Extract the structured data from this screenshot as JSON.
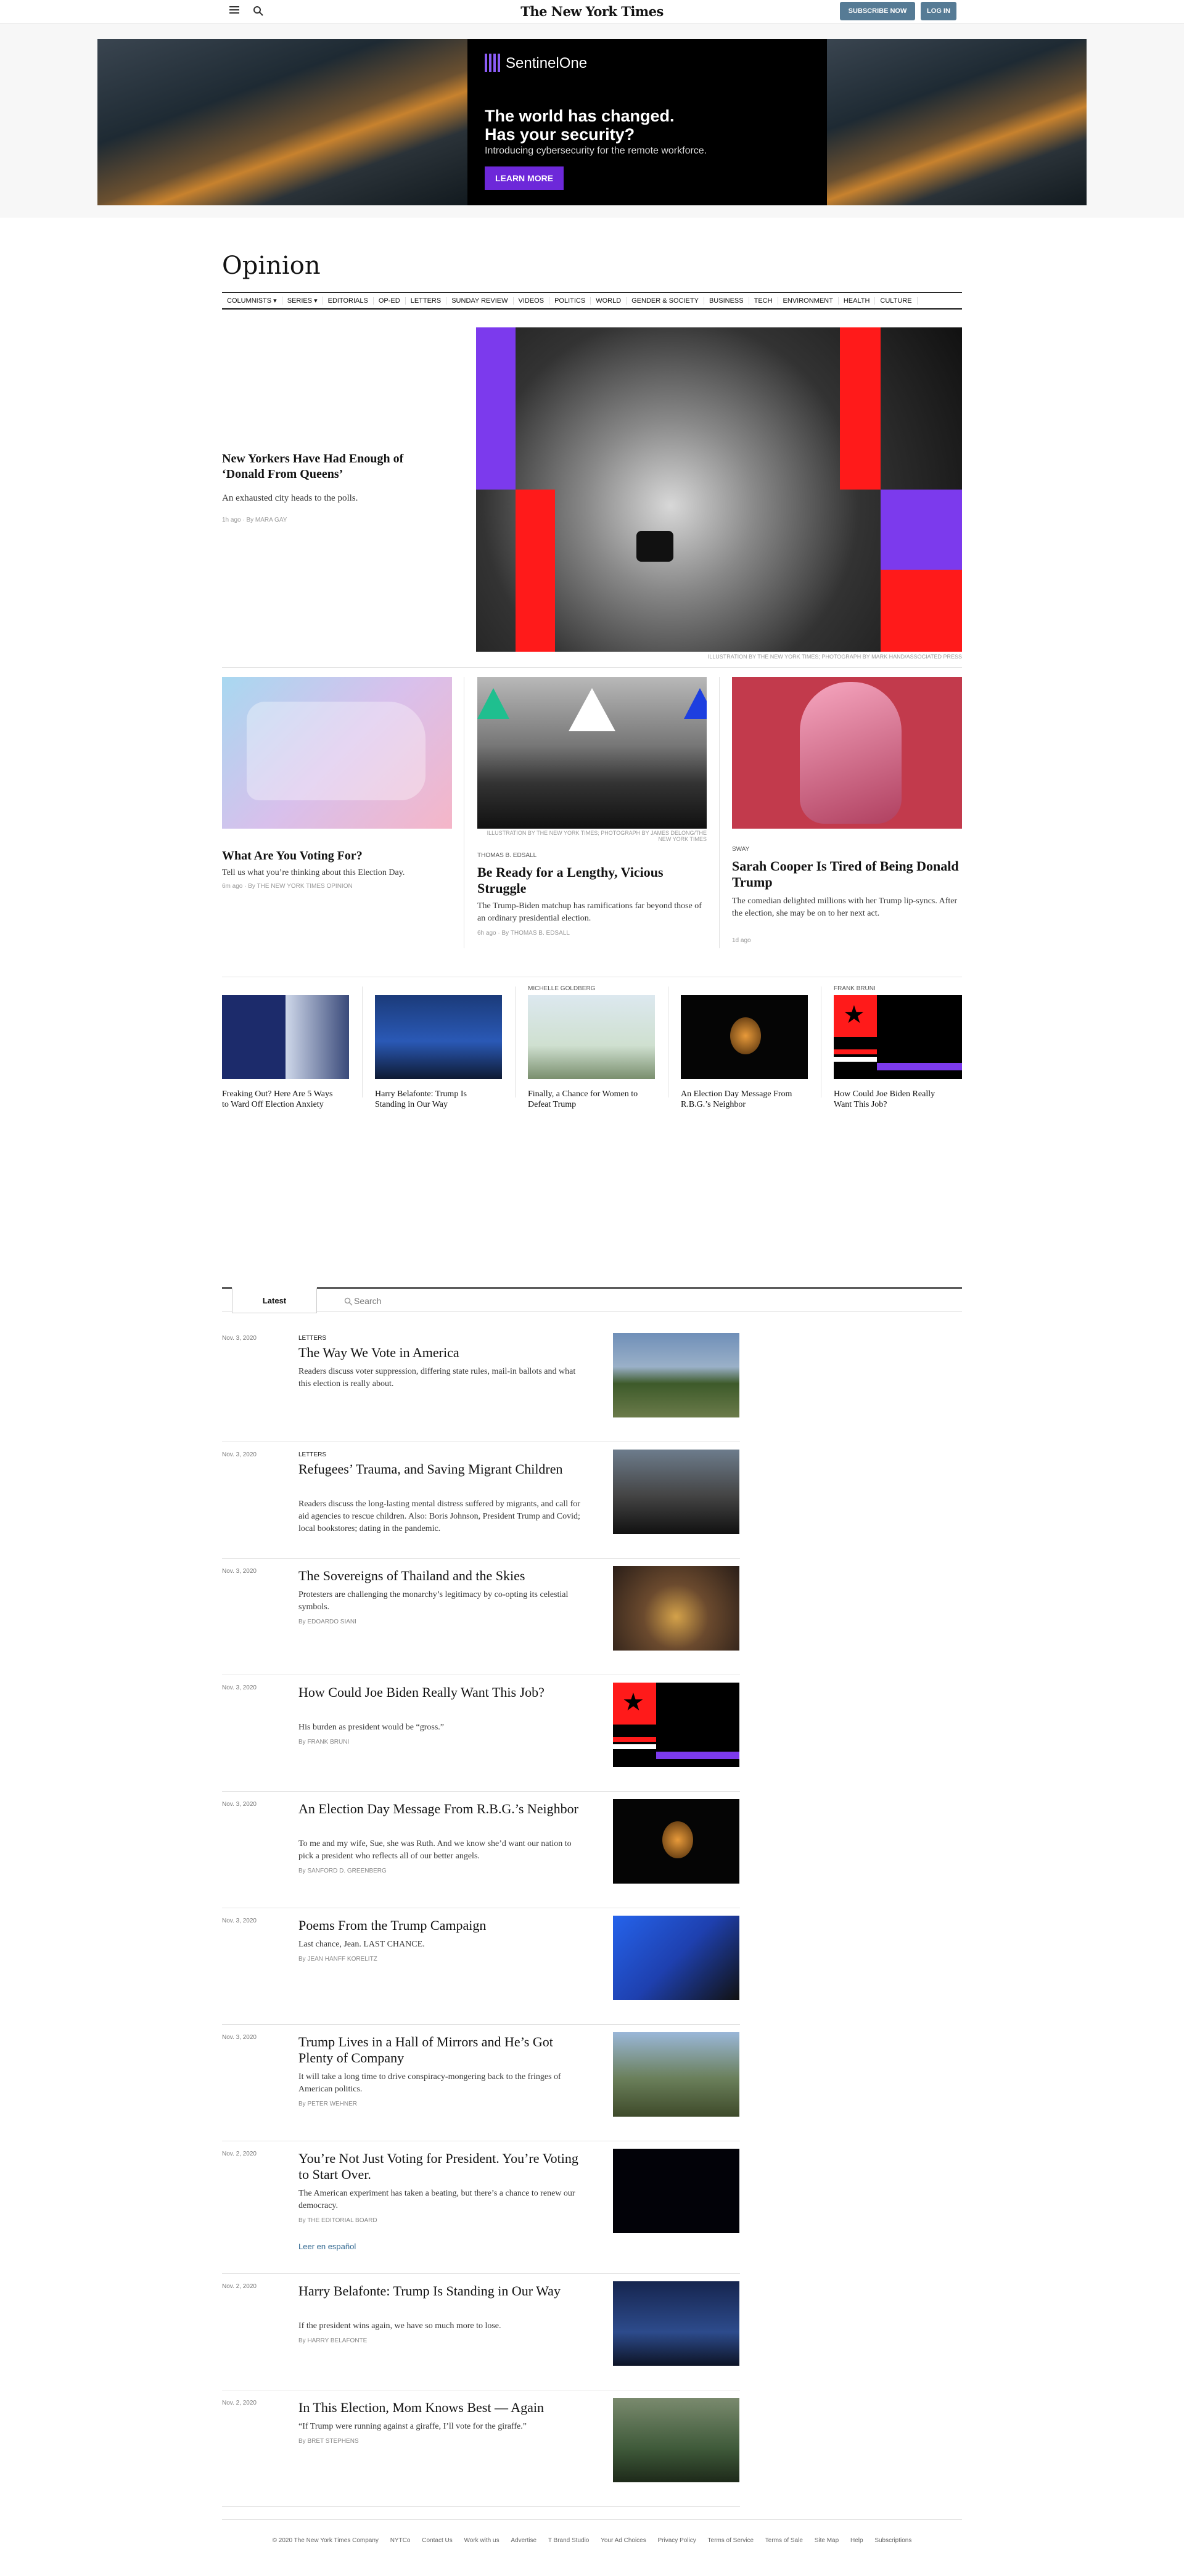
{
  "header": {
    "logo": "The New York Times",
    "subscribe": "SUBSCRIBE NOW",
    "login": "LOG IN"
  },
  "ad": {
    "brand": "SentinelOne",
    "headline1": "The world has changed.",
    "headline2": "Has your security?",
    "subhead": "Introducing cybersecurity for the remote workforce.",
    "cta": "LEARN MORE"
  },
  "section": {
    "title": "Opinion",
    "nav": [
      "COLUMNISTS ▾",
      "SERIES ▾",
      "EDITORIALS",
      "OP-ED",
      "LETTERS",
      "SUNDAY REVIEW",
      "VIDEOS",
      "POLITICS",
      "WORLD",
      "GENDER & SOCIETY",
      "BUSINESS",
      "TECH",
      "ENVIRONMENT",
      "HEALTH",
      "CULTURE"
    ]
  },
  "lead": {
    "title": "New Yorkers Have Had Enough of ‘Donald From Queens’",
    "summary": "An exhausted city heads to the polls.",
    "byline": "1h ago · By MARA GAY",
    "caption": "ILLUSTRATION BY THE NEW YORK TIMES; PHOTOGRAPH BY MARK HAND/ASSOCIATED PRESS"
  },
  "cards": [
    {
      "title": "What Are You Voting For?",
      "summary": "Tell us what you’re thinking about this Election Day.",
      "byline": "6m ago · By THE NEW YORK TIMES OPINION"
    },
    {
      "kicker": "THOMAS B. EDSALL",
      "title": "Be Ready for a Lengthy, Vicious Struggle",
      "summary": "The Trump-Biden matchup has ramifications far beyond those of an ordinary presidential election.",
      "byline": "6h ago · By THOMAS B. EDSALL",
      "caption": "ILLUSTRATION BY THE NEW YORK TIMES; PHOTOGRAPH BY JAMES DELONG/THE NEW YORK TIMES"
    },
    {
      "kicker": "SWAY",
      "title": "Sarah Cooper Is Tired of Being Donald Trump",
      "summary": "The comedian delighted millions with her Trump lip-syncs. After the election, she may be on to her next act.",
      "byline": "1d ago"
    }
  ],
  "small": [
    {
      "kicker": "",
      "title": "Freaking Out? Here Are 5 Ways to Ward Off Election Anxiety"
    },
    {
      "kicker": "",
      "title": "Harry Belafonte: Trump Is Standing in Our Way"
    },
    {
      "kicker": "MICHELLE GOLDBERG",
      "title": "Finally, a Chance for Women to Defeat Trump"
    },
    {
      "kicker": "",
      "title": "An Election Day Message From R.B.G.’s Neighbor"
    },
    {
      "kicker": "FRANK BRUNI",
      "title": "How Could Joe Biden Really Want This Job?"
    }
  ],
  "latest": {
    "tab": "Latest",
    "search_placeholder": "Search",
    "items": [
      {
        "date": "Nov. 3, 2020",
        "kicker": "LETTERS",
        "title": "The Way We Vote in America",
        "summary": "Readers discuss voter suppression, differing state rules, mail-in ballots and what this election is really about.",
        "byline": ""
      },
      {
        "date": "Nov. 3, 2020",
        "kicker": "LETTERS",
        "title": "Refugees’ Trauma, and Saving Migrant Children",
        "summary": "Readers discuss the long-lasting mental distress suffered by migrants, and call for aid agencies to rescue children. Also: Boris Johnson, President Trump and Covid; local bookstores; dating in the pandemic.",
        "byline": ""
      },
      {
        "date": "Nov. 3, 2020",
        "kicker": "",
        "title": "The Sovereigns of Thailand and the Skies",
        "summary": "Protesters are challenging the monarchy’s legitimacy by co-opting its celestial symbols.",
        "byline": "By EDOARDO SIANI"
      },
      {
        "date": "Nov. 3, 2020",
        "kicker": "",
        "title": "How Could Joe Biden Really Want This Job?",
        "summary": "His burden as president would be “gross.”",
        "byline": "By FRANK BRUNI"
      },
      {
        "date": "Nov. 3, 2020",
        "kicker": "",
        "title": "An Election Day Message From R.B.G.’s Neighbor",
        "summary": "To me and my wife, Sue, she was Ruth. And we know she’d want our nation to pick a president who reflects all of our better angels.",
        "byline": "By SANFORD D. GREENBERG"
      },
      {
        "date": "Nov. 3, 2020",
        "kicker": "",
        "title": "Poems From the Trump Campaign",
        "summary": "Last chance, Jean. LAST CHANCE.",
        "byline": "By JEAN HANFF KORELITZ"
      },
      {
        "date": "Nov. 3, 2020",
        "kicker": "",
        "title": "Trump Lives in a Hall of Mirrors and He’s Got Plenty of Company",
        "summary": "It will take a long time to drive conspiracy-mongering back to the fringes of American politics.",
        "byline": "By PETER WEHNER"
      },
      {
        "date": "Nov. 2, 2020",
        "kicker": "",
        "title": "You’re Not Just Voting for President. You’re Voting to Start Over.",
        "summary": "The American experiment has taken a beating, but there’s a chance to renew our democracy.",
        "byline": "By THE EDITORIAL BOARD",
        "link": "Leer en español"
      },
      {
        "date": "Nov. 2, 2020",
        "kicker": "",
        "title": "Harry Belafonte: Trump Is Standing in Our Way",
        "summary": "If the president wins again, we have so much more to lose.",
        "byline": "By HARRY BELAFONTE"
      },
      {
        "date": "Nov. 2, 2020",
        "kicker": "",
        "title": "In This Election, Mom Knows Best — Again",
        "summary": "“If Trump were running against a giraffe, I’ll vote for the giraffe.”",
        "byline": "By BRET STEPHENS"
      }
    ]
  },
  "footer": [
    "© 2020 The New York Times Company",
    "NYTCo",
    "Contact Us",
    "Work with us",
    "Advertise",
    "T Brand Studio",
    "Your Ad Choices",
    "Privacy Policy",
    "Terms of Service",
    "Terms of Sale",
    "Site Map",
    "Help",
    "Subscriptions"
  ]
}
